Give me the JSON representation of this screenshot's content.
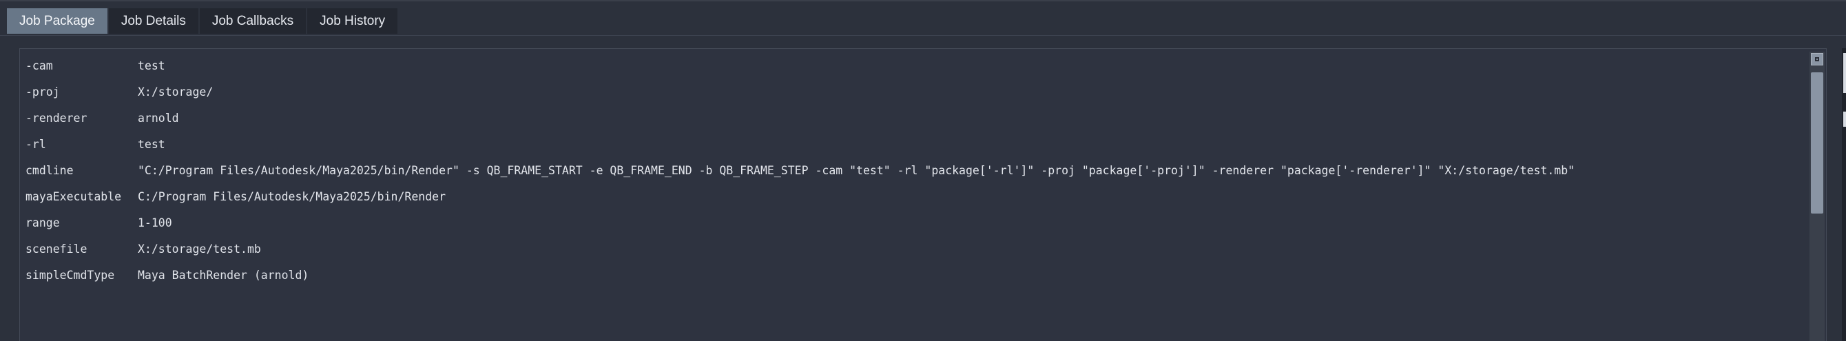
{
  "tabs": [
    {
      "label": "Job Package",
      "active": true
    },
    {
      "label": "Job Details",
      "active": false
    },
    {
      "label": "Job Callbacks",
      "active": false
    },
    {
      "label": "Job History",
      "active": false
    }
  ],
  "package": [
    {
      "key": "-cam",
      "value": "test"
    },
    {
      "key": "-proj",
      "value": "X:/storage/"
    },
    {
      "key": "-renderer",
      "value": "arnold"
    },
    {
      "key": "-rl",
      "value": "test"
    },
    {
      "key": "cmdline",
      "value": "\"C:/Program Files/Autodesk/Maya2025/bin/Render\" -s QB_FRAME_START -e QB_FRAME_END -b QB_FRAME_STEP -cam \"test\" -rl \"package['-rl']\" -proj \"package['-proj']\" -renderer \"package['-renderer']\" \"X:/storage/test.mb\""
    },
    {
      "key": "mayaExecutable",
      "value": "C:/Program Files/Autodesk/Maya2025/bin/Render"
    },
    {
      "key": "range",
      "value": "1-100"
    },
    {
      "key": "scenefile",
      "value": "X:/storage/test.mb"
    },
    {
      "key": "simpleCmdType",
      "value": "Maya BatchRender (arnold)"
    }
  ],
  "colors": {
    "background": "#2c313c",
    "tab_active": "#687788",
    "tab_inactive": "#232730",
    "text": "#e1e4ea",
    "scroll_thumb": "#8a95a4"
  }
}
